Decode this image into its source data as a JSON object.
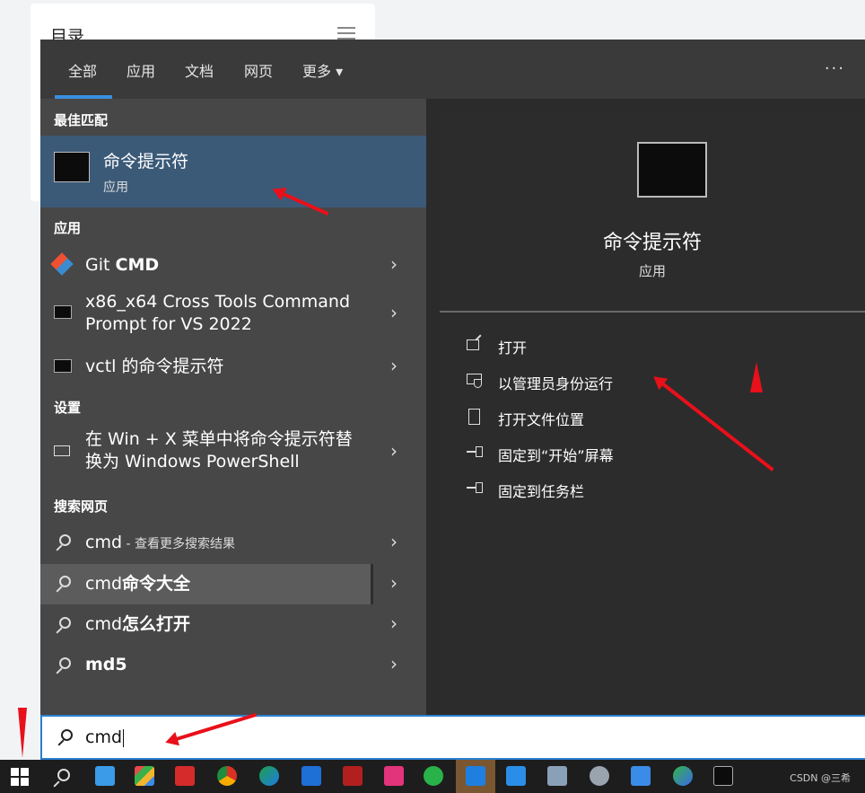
{
  "page": {
    "toc_title": "目录"
  },
  "tabs": [
    {
      "label": "全部"
    },
    {
      "label": "应用"
    },
    {
      "label": "文档"
    },
    {
      "label": "网页"
    },
    {
      "label": "更多 ▾"
    }
  ],
  "more_menu": "···",
  "best_match": {
    "section": "最佳匹配",
    "title": "命令提示符",
    "subtitle": "应用"
  },
  "apps": {
    "section": "应用",
    "items": [
      {
        "label_prefix": "Git ",
        "label_bold": "CMD"
      },
      {
        "line1": "x86_x64 Cross Tools Command",
        "line2": "Prompt for VS 2022"
      },
      {
        "label": "vctl 的命令提示符"
      }
    ]
  },
  "settings": {
    "section": "设置",
    "item_line1": "在 Win + X 菜单中将命令提示符替",
    "item_line2": "换为 Windows PowerShell"
  },
  "web": {
    "section": "搜索网页",
    "items": [
      {
        "label": "cmd",
        "suffix": " - 查看更多搜索结果"
      },
      {
        "label_prefix": "cmd",
        "label_bold": "命令大全"
      },
      {
        "label_prefix": "cmd",
        "label_bold": "怎么打开"
      },
      {
        "label_bold": "md5"
      }
    ]
  },
  "preview": {
    "title": "命令提示符",
    "subtitle": "应用",
    "actions": [
      {
        "label": "打开",
        "icon": "open-icon"
      },
      {
        "label": "以管理员身份运行",
        "icon": "shield-icon"
      },
      {
        "label": "打开文件位置",
        "icon": "file-location-icon"
      },
      {
        "label": "固定到“开始”屏幕",
        "icon": "pin-icon"
      },
      {
        "label": "固定到任务栏",
        "icon": "pin-icon"
      }
    ]
  },
  "search": {
    "value": "cmd"
  },
  "taskbar": {
    "watermark": "CSDN @三希"
  },
  "colors": {
    "accent": "#2b80d0",
    "selected": "#3b5a78",
    "annotation": "#e8101a"
  }
}
